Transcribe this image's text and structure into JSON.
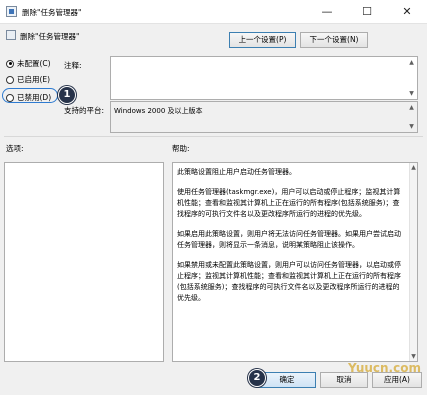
{
  "window": {
    "title": "删除\"任务管理器\"",
    "minimize_glyph": "—",
    "maximize_glyph": "☐",
    "close_glyph": "✕"
  },
  "header": {
    "policy_name": "删除\"任务管理器\"",
    "prev_setting_label": "上一个设置(P)",
    "next_setting_label": "下一个设置(N)"
  },
  "state_options": [
    {
      "label": "未配置(C)",
      "checked": true
    },
    {
      "label": "已启用(E)",
      "checked": false
    },
    {
      "label": "已禁用(D)",
      "checked": false
    }
  ],
  "comment": {
    "label": "注释:",
    "value": ""
  },
  "supported_on": {
    "label": "支持的平台:",
    "value": "Windows 2000 及以上版本"
  },
  "options_label": "选项:",
  "help_label": "帮助:",
  "help_paragraphs": [
    "此策略设置阻止用户启动任务管理器。",
    "使用任务管理器(taskmgr.exe)，用户可以启动或停止程序；监视其计算机性能；查看和监视其计算机上正在运行的所有程序(包括系统服务)；查找程序的可执行文件名以及更改程序所运行的进程的优先级。",
    "如果启用此策略设置，则用户将无法访问任务管理器。如果用户尝试启动任务管理器，则将显示一条消息，说明某策略阻止该操作。",
    "如果禁用或未配置此策略设置，则用户可以访问任务管理器，以启动或停止程序；监视其计算机性能；查看和监视其计算机上正在运行的所有程序(包括系统服务)；查找程序的可执行文件名以及更改程序所运行的进程的优先级。"
  ],
  "footer": {
    "ok_label": "确定",
    "cancel_label": "取消",
    "apply_label": "应用(A)"
  },
  "annotations": {
    "step1": "1",
    "step2": "2"
  },
  "watermark": "Yuucn.com",
  "colors": {
    "accent_blue": "#2e7bd0",
    "badge_navy": "#27334a",
    "watermark_gold": "#d9b24a"
  }
}
